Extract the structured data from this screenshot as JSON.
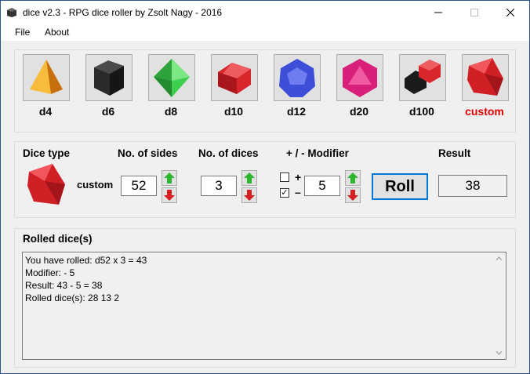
{
  "window": {
    "title": "dice v2.3 - RPG dice roller by Zsolt Nagy - 2016"
  },
  "menu": {
    "items": [
      "File",
      "About"
    ]
  },
  "dice": [
    {
      "label": "d4",
      "color": "#f2a21a",
      "selected": false
    },
    {
      "label": "d6",
      "color": "#2a2a2a",
      "selected": false
    },
    {
      "label": "d8",
      "color": "#3fcf4f",
      "selected": false
    },
    {
      "label": "d10",
      "color": "#d9262c",
      "selected": false
    },
    {
      "label": "d12",
      "color": "#3d4fd8",
      "selected": false
    },
    {
      "label": "d20",
      "color": "#d81f7a",
      "selected": false
    },
    {
      "label": "d100",
      "color": "#1b1b1b",
      "selected": false
    },
    {
      "label": "custom",
      "color": "#d01f25",
      "selected": true
    }
  ],
  "controls": {
    "dice_type_header": "Dice type",
    "sides_header": "No. of sides",
    "dices_header": "No. of dices",
    "modifier_header": "+ / - Modifier",
    "result_header": "Result",
    "dice_type_value": "custom",
    "sides_value": "52",
    "dices_value": "3",
    "plus_label": "+",
    "minus_label": "–",
    "plus_checked": false,
    "minus_checked": true,
    "modifier_value": "5",
    "roll_label": "Roll",
    "result_value": "38"
  },
  "log": {
    "header": "Rolled dice(s)",
    "lines": [
      "You have rolled: d52 x 3 = 43",
      "Modifier: - 5",
      "Result: 43 - 5 = 38",
      "Rolled dice(s):  28 13 2"
    ]
  },
  "colors": {
    "accent": "#0078d7",
    "custom_label": "#e00000",
    "arrow_up": "#2db52d",
    "arrow_down": "#d42020"
  }
}
